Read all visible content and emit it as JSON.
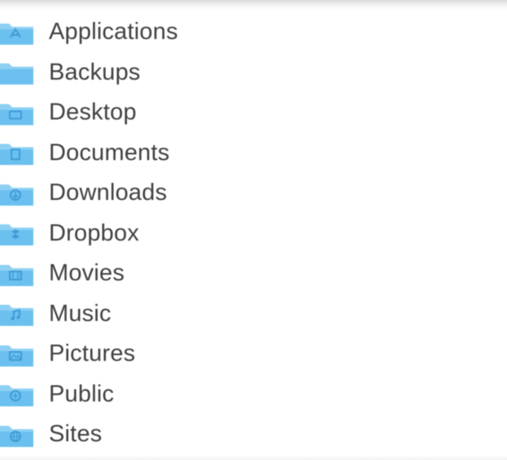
{
  "colors": {
    "folder_body": "#6cc0ef",
    "folder_tab": "#8dd0f4",
    "folder_emblem": "#3f9bd8",
    "label_text": "#404040"
  },
  "folders": [
    {
      "label": "Applications",
      "icon": "applications-folder-icon"
    },
    {
      "label": "Backups",
      "icon": "folder-icon"
    },
    {
      "label": "Desktop",
      "icon": "desktop-folder-icon"
    },
    {
      "label": "Documents",
      "icon": "documents-folder-icon"
    },
    {
      "label": "Downloads",
      "icon": "downloads-folder-icon"
    },
    {
      "label": "Dropbox",
      "icon": "dropbox-folder-icon"
    },
    {
      "label": "Movies",
      "icon": "movies-folder-icon"
    },
    {
      "label": "Music",
      "icon": "music-folder-icon"
    },
    {
      "label": "Pictures",
      "icon": "pictures-folder-icon"
    },
    {
      "label": "Public",
      "icon": "public-folder-icon"
    },
    {
      "label": "Sites",
      "icon": "sites-folder-icon"
    }
  ]
}
